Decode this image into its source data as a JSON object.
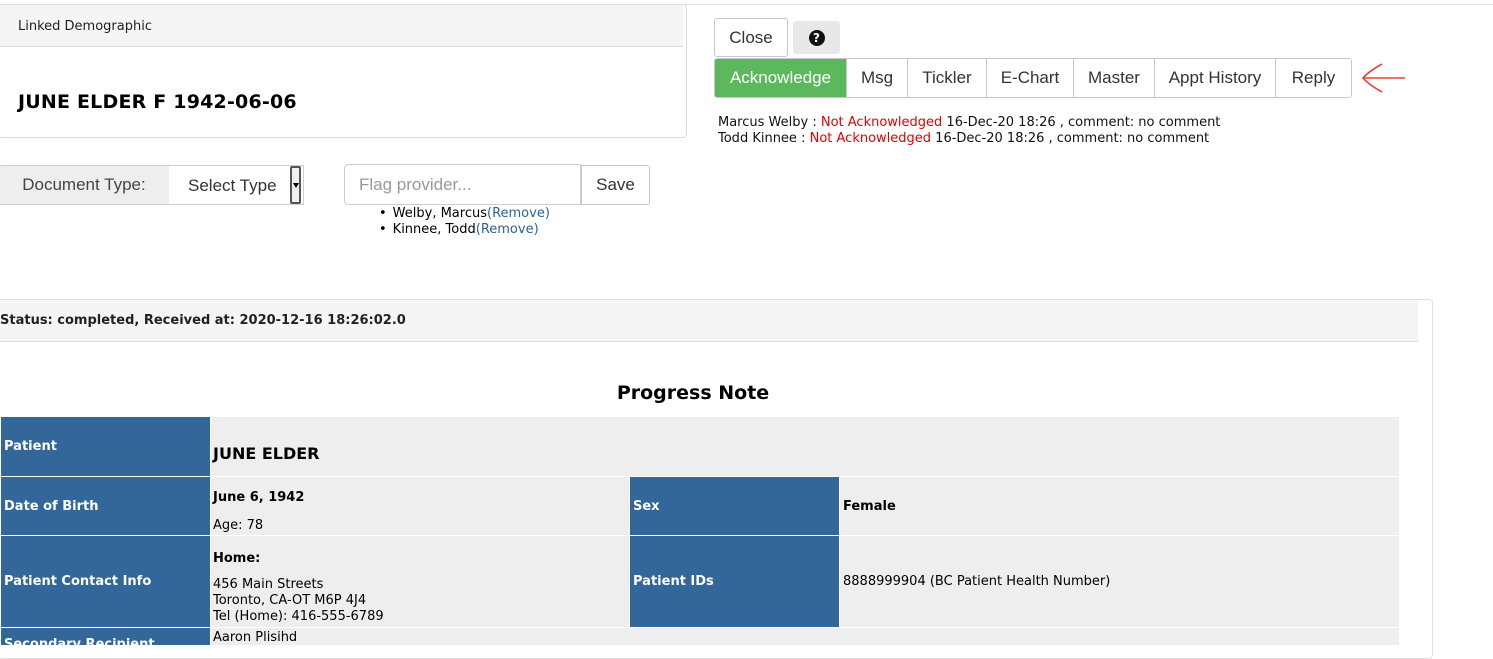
{
  "demographic": {
    "header": "Linked Demographic",
    "patient_line": "JUNE ELDER F 1942-06-06"
  },
  "toolbar": {
    "close_label": "Close",
    "help_icon": "question-circle-icon",
    "actions": [
      {
        "label": "Acknowledge",
        "name": "acknowledge-button"
      },
      {
        "label": "Msg",
        "name": "msg-button"
      },
      {
        "label": "Tickler",
        "name": "tickler-button"
      },
      {
        "label": "E-Chart",
        "name": "echart-button"
      },
      {
        "label": "Master",
        "name": "master-button"
      },
      {
        "label": "Appt History",
        "name": "appt-history-button"
      },
      {
        "label": "Reply",
        "name": "reply-button"
      }
    ],
    "accent_color": "#5cb85c"
  },
  "acknowledgements": [
    {
      "provider": "Marcus Welby :",
      "status": "Not Acknowledged",
      "detail": "16-Dec-20 18:26 , comment: no comment"
    },
    {
      "provider": "Todd Kinnee :",
      "status": "Not Acknowledged",
      "detail": "16-Dec-20 18:26 , comment: no comment"
    }
  ],
  "document_type": {
    "label": "Document Type:",
    "selected": "Select Type"
  },
  "flag_provider": {
    "placeholder": "Flag provider...",
    "save_label": "Save",
    "providers": [
      {
        "name": "Welby, Marcus",
        "remove": "(Remove)"
      },
      {
        "name": "Kinnee, Todd",
        "remove": "(Remove)"
      }
    ]
  },
  "document": {
    "status": "Status: completed, Received at: 2020-12-16 18:26:02.0",
    "title": "Progress Note",
    "patient_label": "Patient",
    "patient_value": "JUNE ELDER",
    "dob_label": "Date of Birth",
    "dob_value": "June 6, 1942",
    "age_value": "Age: 78",
    "sex_label": "Sex",
    "sex_value": "Female",
    "contact_label": "Patient Contact Info",
    "contact_home_label": "Home:",
    "contact_address1": "456 Main Streets",
    "contact_address2": "Toronto, CA-OT M6P 4J4",
    "contact_phone": "Tel (Home): 416-555-6789",
    "ids_label": "Patient IDs",
    "ids_value": "8888999904 (BC Patient Health Number)",
    "secondary_label": "Secondary Recipient",
    "secondary_value": "Aaron Plisihd"
  }
}
